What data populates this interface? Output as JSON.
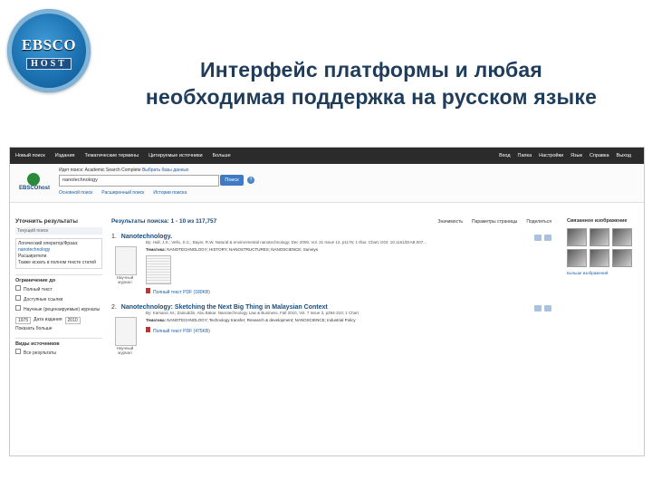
{
  "logo": {
    "brand_top": "EBSCO",
    "brand_bottom": "HOST"
  },
  "slide": {
    "title_line1": "Интерфейс платформы и любая",
    "title_line2": "необходимая поддержка на русском языке"
  },
  "screenshot": {
    "topnav": {
      "items": [
        "Новый поиск",
        "Издания",
        "Тематические термины",
        "Цитируемые источники",
        "Больше"
      ],
      "right": [
        "Вход",
        "Папка",
        "Настройки",
        "Язык",
        "Справка",
        "Выход"
      ]
    },
    "search": {
      "label_prefix": "Идет поиск:",
      "label_db": "Academic Search Complete",
      "label_link": "Выбрать базы данных",
      "query": "nanotechnology",
      "button": "Поиск",
      "help": "?",
      "links": [
        "Основной поиск",
        "Расширенный поиск",
        "Истории поиска"
      ],
      "logo_text": "EBSCOhost"
    },
    "left": {
      "refine": "Уточнить результаты",
      "current": "Текущий поиск",
      "box_title": "Логический оператор/Фраза:",
      "box_term": "nanotechnology",
      "expanders": "Расширители",
      "box_also": "Также искать в полном тексте статей",
      "limit": "Ограничение до",
      "chk1": "Полный текст",
      "chk2": "Доступные ссылки",
      "chk3": "Научные (рецензируемые) журналы",
      "date_from": "1975",
      "date_label": "Дата издания",
      "date_to": "2010",
      "options_link": "Показать больше",
      "source_types": "Виды источников",
      "all_results": "Все результаты"
    },
    "results": {
      "header": "Результаты поиска: 1 - 10 из 117,757",
      "opts": [
        "Значимость",
        "Параметры страницы",
        "Поделиться"
      ],
      "items": [
        {
          "num": "1.",
          "title": "Nanotechnology.",
          "body": "By: Hall, J.S.; Vello, S.C.; Bayer, R.W. Natural & environmental nanotechnology; Dec 2009, Vol. 31 Issue 12, p1176; 1 Illus. Chart; DOI: 10.1161/DIAB.007...",
          "sub_label": "Тематика:",
          "sub_text": "NANOTECHNOLOGY; HISTORY; NANOSTRUCTURES; NANOSCIENCE; Surveys",
          "thumb_label": "Научный журнал",
          "pdf": "Полный текст PDF (180KB)"
        },
        {
          "num": "2.",
          "title": "Nanotechnology: Sketching the Next Big Thing in Malaysian Context",
          "body": "By: Kamarul, M.; Zainuddin, Abu Bakar. Nanotechnology Law & Business, Fall 2010, Vol. 7 Issue 3, p294-310; 1 Chart",
          "sub_label": "Тематика:",
          "sub_text": "NANOTECHNOLOGY; Technology transfer; Research & development; NANOSCIENCE; Industrial Policy",
          "thumb_label": "Научный журнал",
          "pdf": "Полный текст PDF (475KB)"
        }
      ]
    },
    "right": {
      "title": "Связанное изображение",
      "more": "Больше изображений"
    }
  }
}
